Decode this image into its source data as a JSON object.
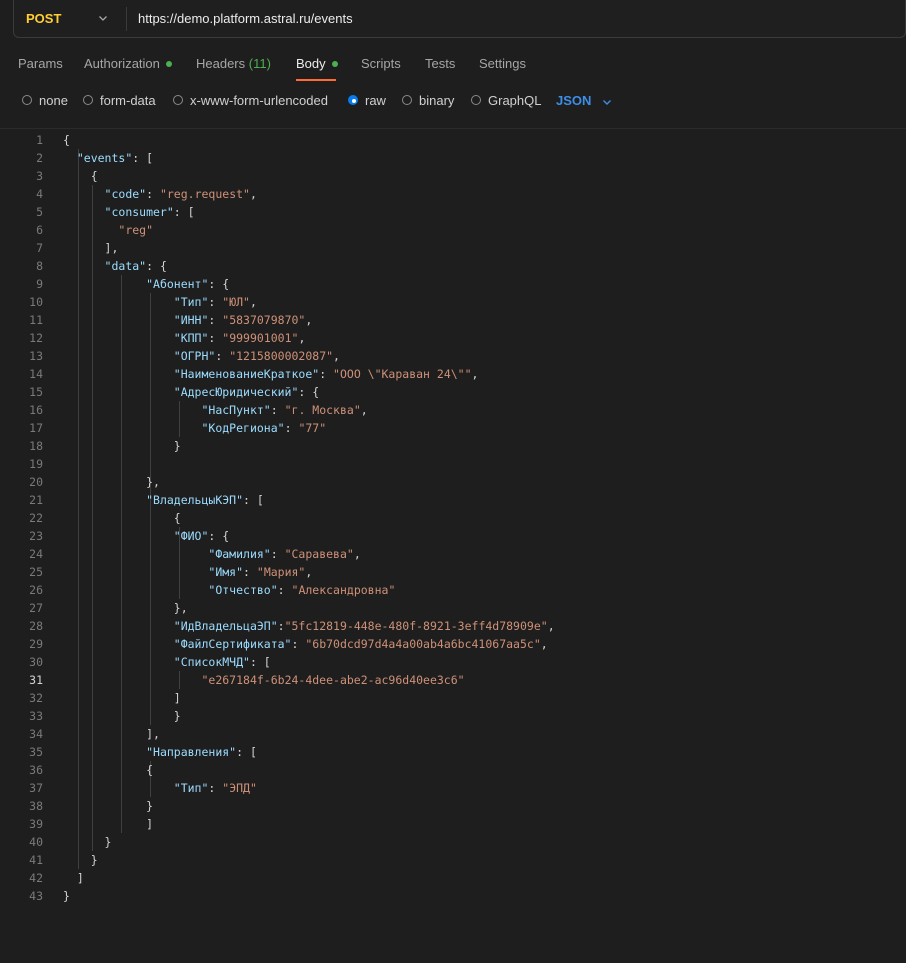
{
  "request": {
    "method": "POST",
    "url": "https://demo.platform.astral.ru/events"
  },
  "tabs": [
    {
      "label": "Params",
      "dot": false
    },
    {
      "label": "Authorization",
      "dot": true
    },
    {
      "label": "Headers",
      "count": "(11)"
    },
    {
      "label": "Body",
      "dot": true,
      "active": true
    },
    {
      "label": "Scripts"
    },
    {
      "label": "Tests"
    },
    {
      "label": "Settings"
    }
  ],
  "body_types": [
    {
      "label": "none",
      "checked": false
    },
    {
      "label": "form-data",
      "checked": false
    },
    {
      "label": "x-www-form-urlencoded",
      "checked": false
    },
    {
      "label": "raw",
      "checked": true
    },
    {
      "label": "binary",
      "checked": false
    },
    {
      "label": "GraphQL",
      "checked": false
    }
  ],
  "format": "JSON",
  "editor": {
    "current_line": 31,
    "lines": [
      "{",
      "  \"events\": [",
      "    {",
      "      \"code\": \"reg.request\",",
      "      \"consumer\": [",
      "        \"reg\"",
      "      ],",
      "      \"data\": {",
      "            \"Абонент\": {",
      "                \"Тип\": \"ЮЛ\",",
      "                \"ИНН\": \"5837079870\",",
      "                \"КПП\": \"999901001\",",
      "                \"ОГРН\": \"1215800002087\",",
      "                \"НаименованиеКраткое\": \"ООО \\\"Караван 24\\\"\",",
      "                \"АдресЮридический\": {",
      "                    \"НасПункт\": \"г. Москва\",",
      "                    \"КодРегиона\": \"77\"",
      "                }",
      "",
      "            },",
      "            \"ВладельцыКЭП\": [",
      "                {",
      "                \"ФИО\": {",
      "                     \"Фамилия\": \"Саравева\",",
      "                     \"Имя\": \"Мария\",",
      "                     \"Отчество\": \"Александровна\"",
      "                },",
      "                \"ИдВладельцаЭП\":\"5fc12819-448e-480f-8921-3eff4d78909e\",",
      "                \"ФайлСертификата\": \"6b70dcd97d4a4a00ab4a6bc41067aa5c\",",
      "                \"СписокМЧД\": [",
      "                    \"e267184f-6b24-4dee-abe2-ac96d40ee3c6\"",
      "                ]",
      "                }",
      "            ],",
      "            \"Направления\": [",
      "            {",
      "                \"Тип\": \"ЭПД\"",
      "            }",
      "            ]",
      "      }",
      "    }",
      "  ]",
      "}"
    ]
  }
}
